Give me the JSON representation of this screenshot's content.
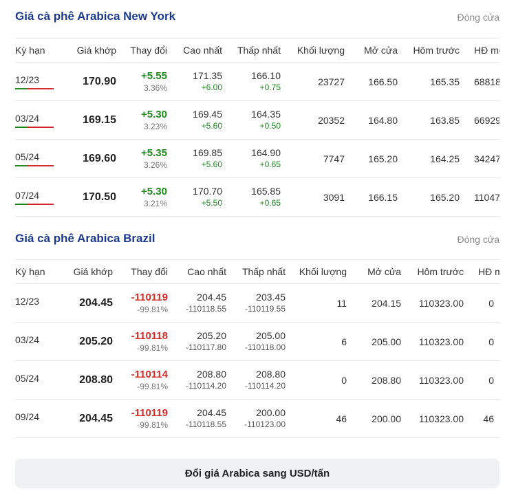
{
  "ny": {
    "title": "Giá cà phê Arabica New York",
    "status": "Đóng cửa",
    "headers": {
      "ky_han": "Kỳ hạn",
      "gia_khop": "Giá khớp",
      "thay_doi": "Thay đổi",
      "cao_nhat": "Cao nhất",
      "thap_nhat": "Thấp nhất",
      "khoi_luong": "Khối lượng",
      "mo_cua": "Mở cửa",
      "hom_truoc": "Hôm trước",
      "hd_mo": "HĐ mở"
    },
    "rows": [
      {
        "ky_han": "12/23",
        "gia_khop": "170.90",
        "change": "+5.55",
        "change_pct": "3.36%",
        "cao": "171.35",
        "cao_chg": "+6.00",
        "thap": "166.10",
        "thap_chg": "+0.75",
        "khoi_luong": "23727",
        "mo_cua": "166.50",
        "hom_truoc": "165.35",
        "hd_mo": "68818"
      },
      {
        "ky_han": "03/24",
        "gia_khop": "169.15",
        "change": "+5.30",
        "change_pct": "3.23%",
        "cao": "169.45",
        "cao_chg": "+5.60",
        "thap": "164.35",
        "thap_chg": "+0.50",
        "khoi_luong": "20352",
        "mo_cua": "164.80",
        "hom_truoc": "163.85",
        "hd_mo": "66929"
      },
      {
        "ky_han": "05/24",
        "gia_khop": "169.60",
        "change": "+5.35",
        "change_pct": "3.26%",
        "cao": "169.85",
        "cao_chg": "+5.60",
        "thap": "164.90",
        "thap_chg": "+0.65",
        "khoi_luong": "7747",
        "mo_cua": "165.20",
        "hom_truoc": "164.25",
        "hd_mo": "34247"
      },
      {
        "ky_han": "07/24",
        "gia_khop": "170.50",
        "change": "+5.30",
        "change_pct": "3.21%",
        "cao": "170.70",
        "cao_chg": "+5.50",
        "thap": "165.85",
        "thap_chg": "+0.65",
        "khoi_luong": "3091",
        "mo_cua": "166.15",
        "hom_truoc": "165.20",
        "hd_mo": "11047"
      }
    ]
  },
  "br": {
    "title": "Giá cà phê Arabica Brazil",
    "status": "Đóng cửa",
    "headers": {
      "ky_han": "Kỳ hạn",
      "gia_khop": "Giá khớp",
      "thay_doi": "Thay đổi",
      "cao_nhat": "Cao nhất",
      "thap_nhat": "Thấp nhất",
      "khoi_luong": "Khối lượng",
      "mo_cua": "Mở cửa",
      "hom_truoc": "Hôm trước",
      "hd_mo": "HĐ mở"
    },
    "rows": [
      {
        "ky_han": "12/23",
        "gia_khop": "204.45",
        "change": "-110119",
        "change_pct": "-99.81%",
        "cao": "204.45",
        "cao_chg": "-110118.55",
        "thap": "203.45",
        "thap_chg": "-110119.55",
        "khoi_luong": "11",
        "mo_cua": "204.15",
        "hom_truoc": "110323.00",
        "hd_mo": "0"
      },
      {
        "ky_han": "03/24",
        "gia_khop": "205.20",
        "change": "-110118",
        "change_pct": "-99.81%",
        "cao": "205.20",
        "cao_chg": "-110117.80",
        "thap": "205.00",
        "thap_chg": "-110118.00",
        "khoi_luong": "6",
        "mo_cua": "205.00",
        "hom_truoc": "110323.00",
        "hd_mo": "0"
      },
      {
        "ky_han": "05/24",
        "gia_khop": "208.80",
        "change": "-110114",
        "change_pct": "-99.81%",
        "cao": "208.80",
        "cao_chg": "-110114.20",
        "thap": "208.80",
        "thap_chg": "-110114.20",
        "khoi_luong": "0",
        "mo_cua": "208.80",
        "hom_truoc": "110323.00",
        "hd_mo": "0"
      },
      {
        "ky_han": "09/24",
        "gia_khop": "204.45",
        "change": "-110119",
        "change_pct": "-99.81%",
        "cao": "204.45",
        "cao_chg": "-110118.55",
        "thap": "200.00",
        "thap_chg": "-110123.00",
        "khoi_luong": "46",
        "mo_cua": "200.00",
        "hom_truoc": "110323.00",
        "hd_mo": "46"
      }
    ]
  },
  "convert_button": "Đổi giá Arabica sang USD/tấn",
  "colors": {
    "title": "#1b3a8f",
    "up": "#1e8a1e",
    "down": "#d42a2a"
  }
}
